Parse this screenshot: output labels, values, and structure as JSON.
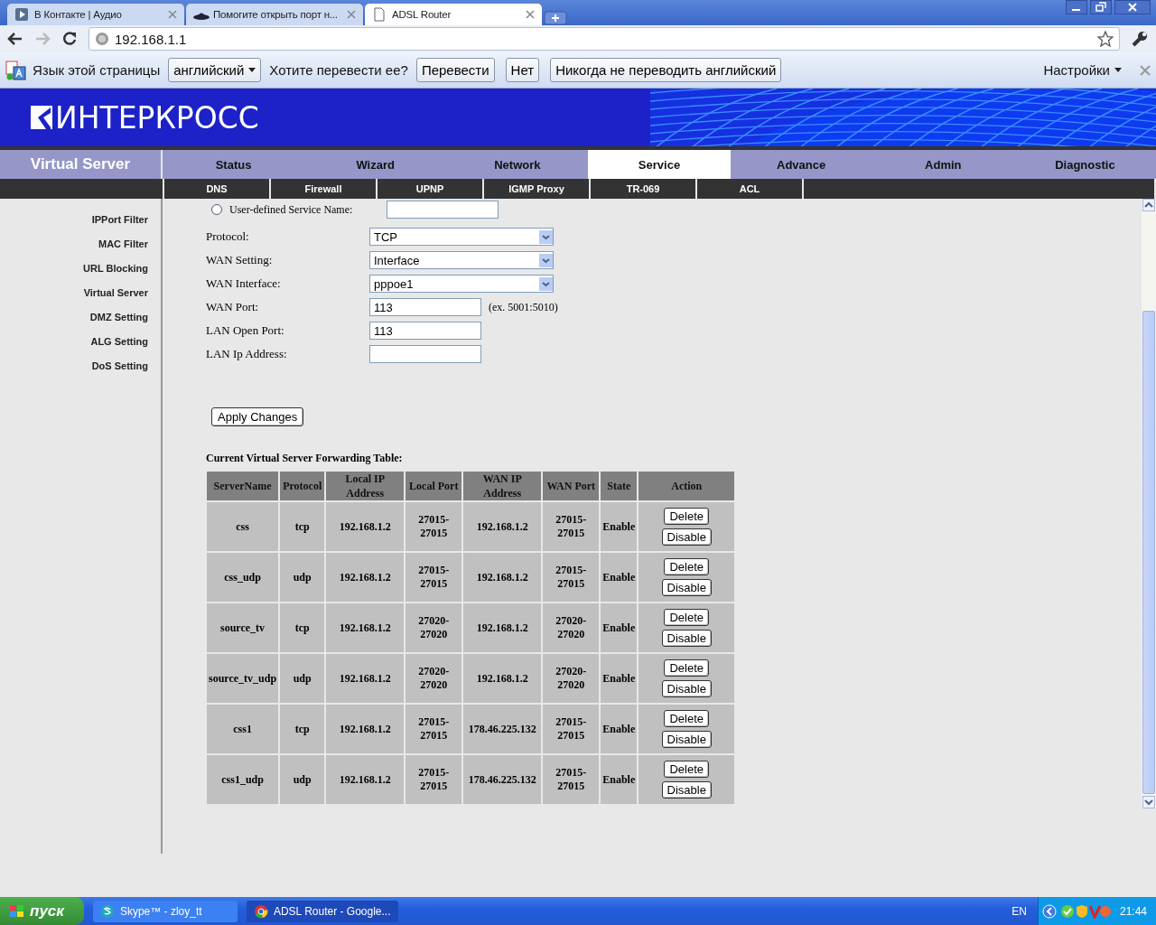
{
  "browser": {
    "tabs": [
      {
        "title": "В Контакте | Аудио",
        "selected": false
      },
      {
        "title": "Помогите открыть порт н...",
        "selected": false
      },
      {
        "title": "ADSL Router",
        "selected": true
      }
    ],
    "address": "192.168.1.1",
    "translate_bar": {
      "label": "Язык этой страницы",
      "language": "английский",
      "question": "Хотите перевести ее?",
      "buttons": [
        "Перевести",
        "Нет",
        "Никогда не переводить английский"
      ],
      "settings": "Настройки"
    }
  },
  "banner": {
    "logo": "ИНТЕРКРОСС"
  },
  "sidebar": {
    "title": "Virtual Server",
    "items": [
      {
        "label": "IPPort Filter"
      },
      {
        "label": "MAC Filter"
      },
      {
        "label": "URL Blocking"
      },
      {
        "label": "Virtual Server"
      },
      {
        "label": "DMZ Setting"
      },
      {
        "label": "ALG Setting"
      },
      {
        "label": "DoS Setting"
      }
    ]
  },
  "main_nav": [
    {
      "label": "Status",
      "selected": false
    },
    {
      "label": "Wizard",
      "selected": false
    },
    {
      "label": "Network",
      "selected": false
    },
    {
      "label": "Service",
      "selected": true
    },
    {
      "label": "Advance",
      "selected": false
    },
    {
      "label": "Admin",
      "selected": false
    },
    {
      "label": "Diagnostic",
      "selected": false
    }
  ],
  "sub_nav": [
    {
      "label": "DNS"
    },
    {
      "label": "Firewall"
    },
    {
      "label": "UPNP"
    },
    {
      "label": "IGMP Proxy"
    },
    {
      "label": "TR-069"
    },
    {
      "label": "ACL"
    }
  ],
  "form": {
    "service_name": {
      "label": "User-defined Service Name:",
      "selected": false
    },
    "fields": [
      {
        "label": "Protocol:",
        "kind": "select",
        "value": "TCP"
      },
      {
        "label": "WAN Setting:",
        "kind": "select",
        "value": "Interface"
      },
      {
        "label": "WAN Interface:",
        "kind": "select",
        "value": "pppoe1"
      },
      {
        "label": "WAN Port:",
        "kind": "text",
        "value": "113",
        "hint": "(ex. 5001:5010)"
      },
      {
        "label": "LAN Open Port:",
        "kind": "text",
        "value": "113"
      },
      {
        "label": "LAN Ip Address:",
        "kind": "text"
      }
    ],
    "apply_button": "Apply Changes"
  },
  "table": {
    "title": "Current Virtual Server Forwarding Table:",
    "columns": [
      "ServerName",
      "Protocol",
      "Local IP Address",
      "Local Port",
      "WAN IP Address",
      "WAN Port",
      "State",
      "Action"
    ],
    "rows": [
      {
        "cells": [
          "css",
          "tcp",
          "192.168.1.2",
          "27015-27015",
          "192.168.1.2",
          "27015-27015",
          "Enable"
        ],
        "actions": [
          "Delete",
          "Disable"
        ]
      },
      {
        "cells": [
          "css_udp",
          "udp",
          "192.168.1.2",
          "27015-27015",
          "192.168.1.2",
          "27015-27015",
          "Enable"
        ],
        "actions": [
          "Delete",
          "Disable"
        ]
      },
      {
        "cells": [
          "source_tv",
          "tcp",
          "192.168.1.2",
          "27020-27020",
          "192.168.1.2",
          "27020-27020",
          "Enable"
        ],
        "actions": [
          "Delete",
          "Disable"
        ]
      },
      {
        "cells": [
          "source_tv_udp",
          "udp",
          "192.168.1.2",
          "27020-27020",
          "192.168.1.2",
          "27020-27020",
          "Enable"
        ],
        "actions": [
          "Delete",
          "Disable"
        ]
      },
      {
        "cells": [
          "css1",
          "tcp",
          "192.168.1.2",
          "27015-27015",
          "178.46.225.132",
          "27015-27015",
          "Enable"
        ],
        "actions": [
          "Delete",
          "Disable"
        ]
      },
      {
        "cells": [
          "css1_udp",
          "udp",
          "192.168.1.2",
          "27015-27015",
          "178.46.225.132",
          "27015-27015",
          "Enable"
        ],
        "actions": [
          "Delete",
          "Disable"
        ]
      }
    ]
  },
  "taskbar": {
    "start": "пуск",
    "items": [
      {
        "label": "Skype™ - zloy_tt",
        "selected": false
      },
      {
        "label": "ADSL Router - Google...",
        "selected": true
      }
    ],
    "language": "EN",
    "clock": "21:44"
  }
}
